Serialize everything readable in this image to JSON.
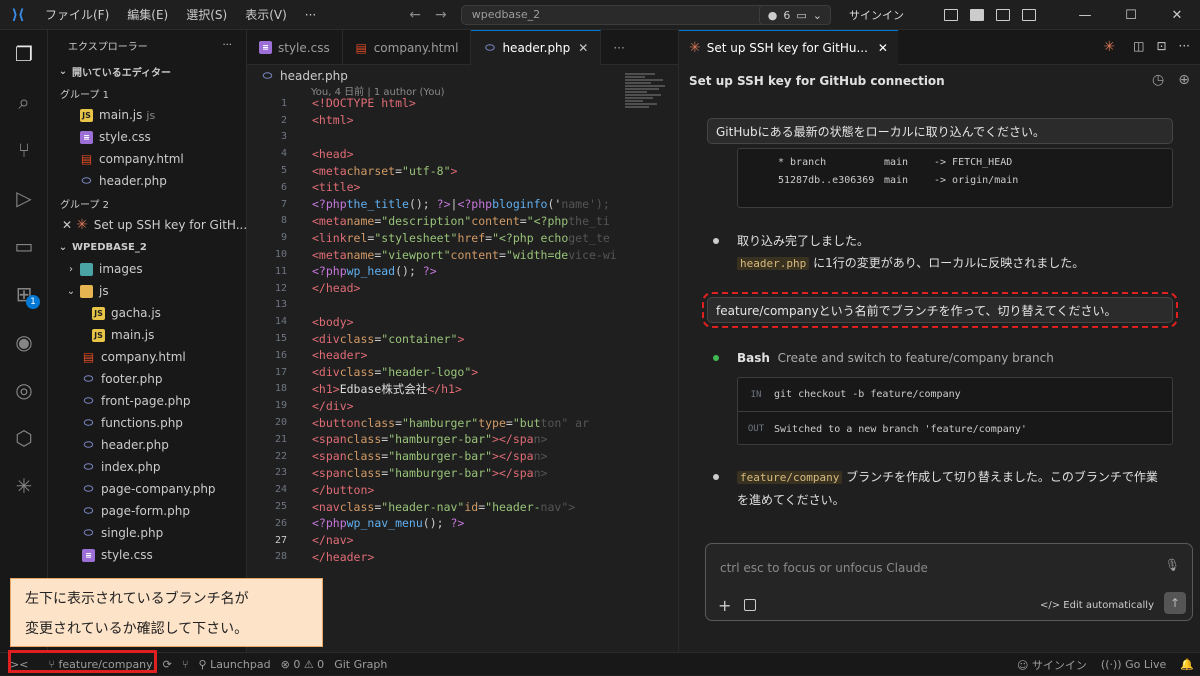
{
  "titlebar": {
    "menu": [
      "ファイル(F)",
      "編集(E)",
      "選択(S)",
      "表示(V)",
      "···"
    ],
    "search": "wpedbase_2",
    "pill_count": "6",
    "signin": "サインイン"
  },
  "sidebar": {
    "header": "エクスプローラー",
    "open_editors": "開いているエディター",
    "group1": "グループ 1",
    "group1_files": [
      {
        "name": "main.js",
        "sub": "js"
      },
      {
        "name": "style.css",
        "sub": ""
      },
      {
        "name": "company.html",
        "sub": ""
      },
      {
        "name": "header.php",
        "sub": ""
      }
    ],
    "group2": "グループ 2",
    "group2_file": "Set up SSH key for GitH...",
    "project": "WPEDBASE_2",
    "folder_images": "images",
    "folder_js": "js",
    "js_files": [
      "gacha.js",
      "main.js"
    ],
    "root_files": [
      "company.html",
      "footer.php",
      "front-page.php",
      "functions.php",
      "header.php",
      "index.php",
      "page-company.php",
      "page-form.php",
      "single.php",
      "style.css"
    ]
  },
  "editor": {
    "tabs": [
      "style.css",
      "company.html",
      "header.php"
    ],
    "breadcrumb": "header.php",
    "blame": "You, 4 日前 | 1 author (You)"
  },
  "panel": {
    "tab": "Set up SSH key for GitHu...",
    "title": "Set up SSH key for GitHub connection",
    "msg1": "GitHubにある最新の状態をローカルに取り込んでください。",
    "out_line1_a": "* branch",
    "out_line1_b": "main",
    "out_line1_c": "-> FETCH_HEAD",
    "out_line2_a": "51287db..e306369",
    "out_line2_b": "main",
    "out_line2_c": "-> origin/main",
    "b1_line1": "取り込み完了しました。",
    "b1_chip": "header.php",
    "b1_line2": "に1行の変更があり、ローカルに反映されました。",
    "msg2": "feature/companyという名前でブランチを作って、切り替えてください。",
    "bash_label": "Bash",
    "bash_desc": "Create and switch to feature/company branch",
    "io_in_label": "IN",
    "io_in": "git checkout -b feature/company",
    "io_out_label": "OUT",
    "io_out": "Switched to a new branch 'feature/company'",
    "b3_chip": "feature/company",
    "b3_text1": "ブランチを作成して切り替えました。このブランチで作業",
    "b3_text2": "を進めてください。",
    "input_placeholder": "ctrl esc to focus or unfocus Claude",
    "edit_label": "Edit automatically"
  },
  "status": {
    "branch": "feature/company",
    "launchpad": "Launchpad",
    "problems": "⊗ 0 ⚠ 0",
    "gitgraph": "Git Graph",
    "signin": "サインイン",
    "golive": "Go Live"
  },
  "callout": {
    "line1": "左下に表示されているブランチ名が",
    "line2": "変更されているか確認して下さい。"
  },
  "colors": {
    "accent": "#0078d4",
    "claude": "#d97757",
    "highlight": "#e02020",
    "callout_bg": "#fde3c8"
  }
}
